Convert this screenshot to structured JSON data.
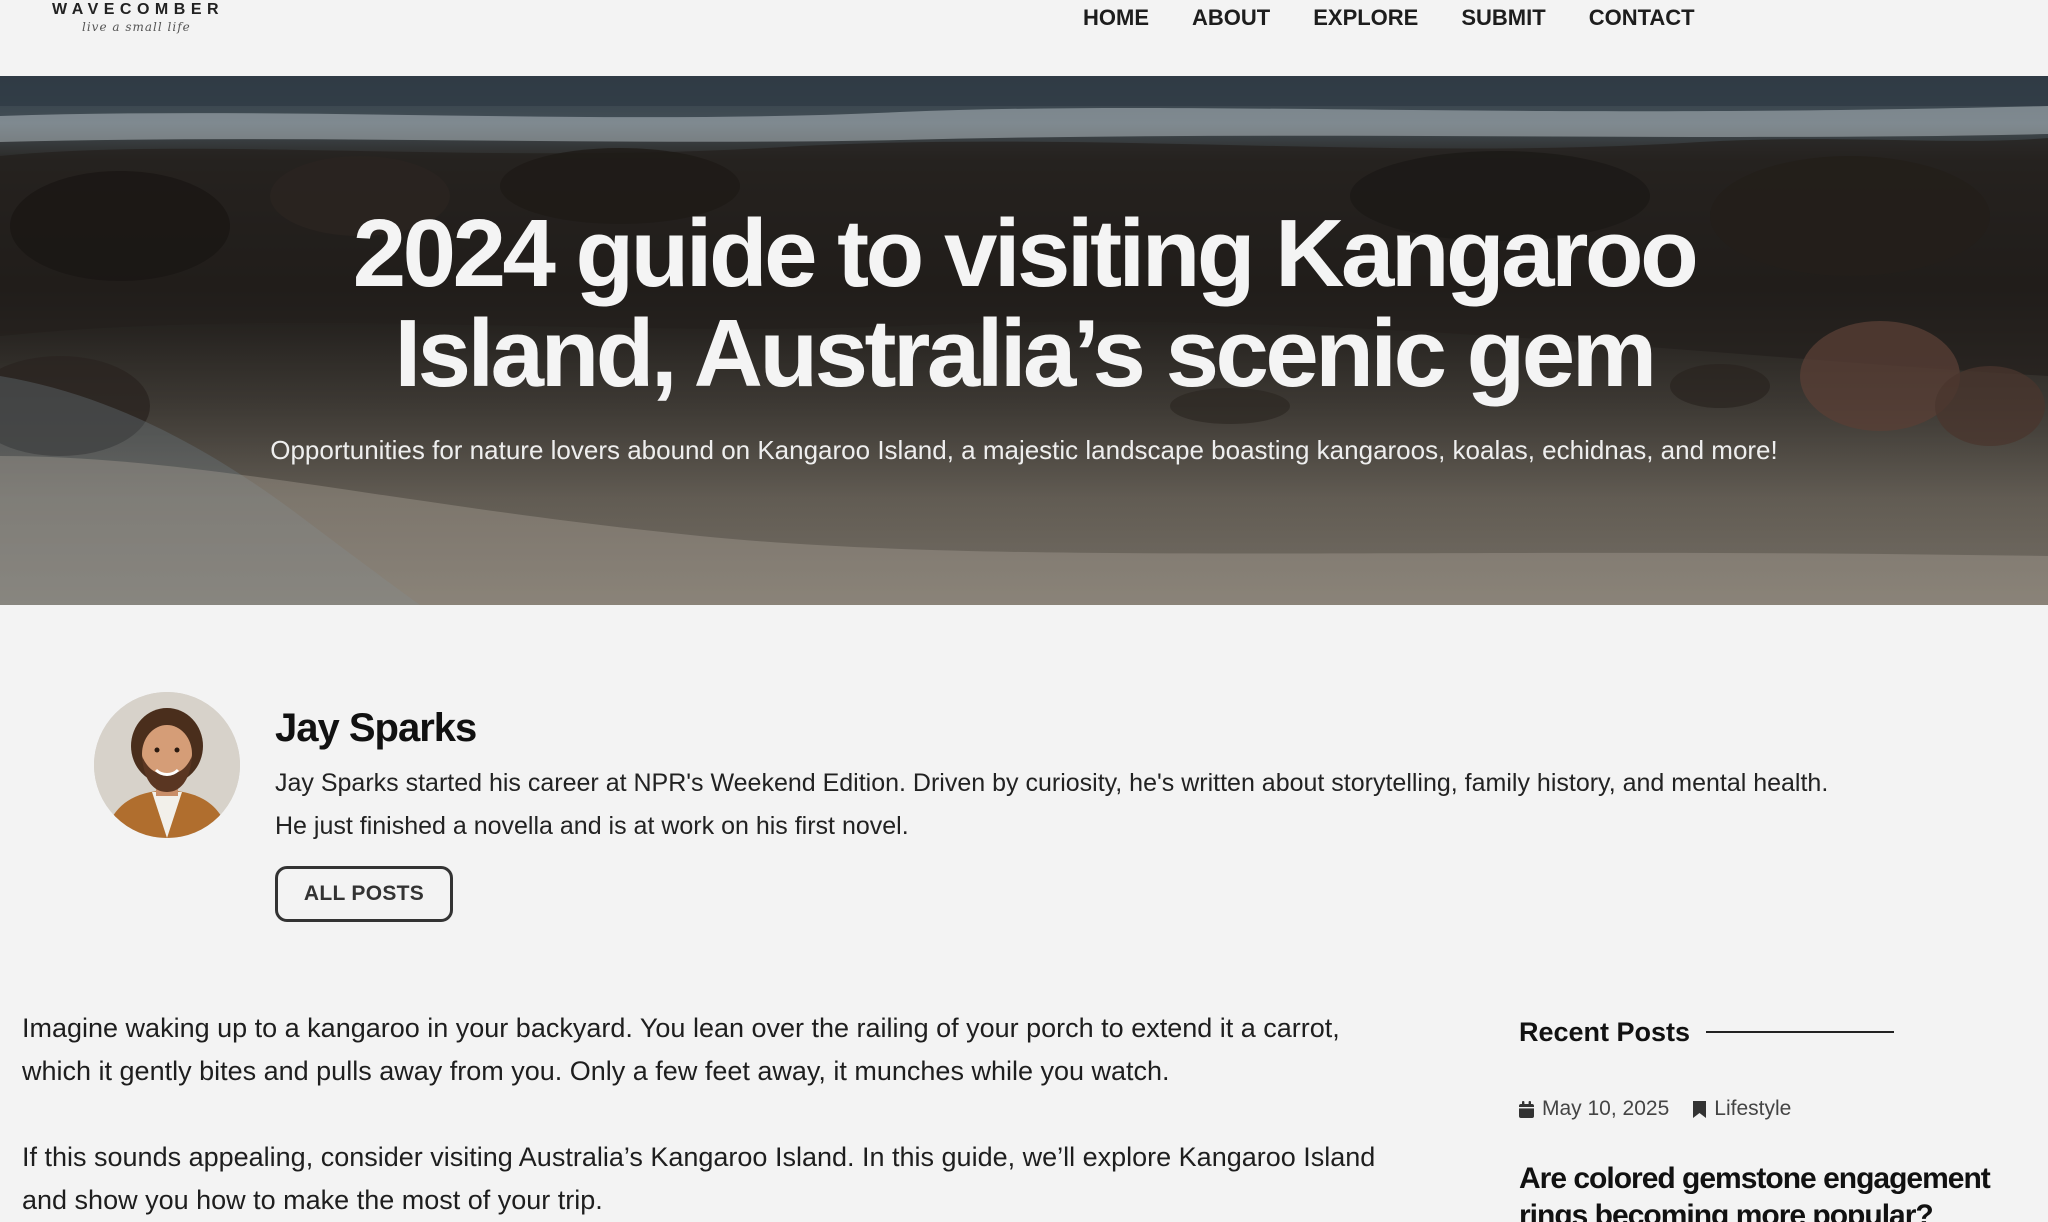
{
  "header": {
    "logo_name": "WAVECOMBER",
    "logo_tagline": "live a small life",
    "nav": [
      "HOME",
      "ABOUT",
      "EXPLORE",
      "SUBMIT",
      "CONTACT"
    ]
  },
  "hero": {
    "title_line1": "2024 guide to visiting Kangaroo",
    "title_line2": "Island, Australia’s scenic gem",
    "subtitle": "Opportunities for nature lovers abound on Kangaroo Island, a majestic landscape boasting kangaroos, koalas, echidnas, and more!"
  },
  "author": {
    "name": "Jay Sparks",
    "bio_line1": "Jay Sparks started his career at NPR's Weekend Edition. Driven by curiosity, he's written about storytelling, family history, and mental health.",
    "bio_line2": "He just finished a novella and is at work on his first novel.",
    "button_label": "ALL POSTS"
  },
  "article": {
    "paragraph1": "Imagine waking up to a kangaroo in your backyard. You lean over the railing of your porch to extend it a carrot, which it gently bites and pulls away from you. Only a few feet away, it munches while you watch.",
    "paragraph2": "If this sounds appealing, consider visiting Australia’s Kangaroo Island. In this guide, we’ll explore Kangaroo Island and show you how to make the most of your trip."
  },
  "sidebar": {
    "title": "Recent Posts",
    "post": {
      "date": "May 10, 2025",
      "category": "Lifestyle",
      "title": "Are colored gemstone engagement rings becoming more popular?"
    }
  },
  "icons": {
    "date": "calendar-icon",
    "category": "bookmark-icon"
  }
}
